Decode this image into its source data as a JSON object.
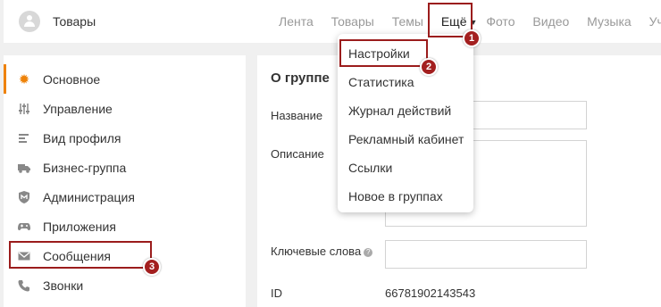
{
  "header": {
    "group_name": "Товары",
    "nav": [
      "Лента",
      "Товары",
      "Темы",
      "Ещё",
      "Фото",
      "Видео",
      "Музыка",
      "Уча"
    ]
  },
  "sidebar": {
    "items": [
      {
        "label": "Основное",
        "icon": "gear-icon"
      },
      {
        "label": "Управление",
        "icon": "sliders-icon"
      },
      {
        "label": "Вид профиля",
        "icon": "lines-icon"
      },
      {
        "label": "Бизнес-группа",
        "icon": "truck-icon"
      },
      {
        "label": "Администрация",
        "icon": "shield-icon"
      },
      {
        "label": "Приложения",
        "icon": "gamepad-icon"
      },
      {
        "label": "Сообщения",
        "icon": "envelope-icon"
      },
      {
        "label": "Звонки",
        "icon": "phone-icon"
      }
    ]
  },
  "dropdown": {
    "items": [
      "Настройки",
      "Статистика",
      "Журнал действий",
      "Рекламный кабинет",
      "Ссылки",
      "Новое в группах"
    ]
  },
  "main": {
    "title": "О группе",
    "name_label": "Название",
    "desc_label": "Описание",
    "keywords_label": "Ключевые слова",
    "help_glyph": "?",
    "id_label": "ID",
    "id_value": "66781902143543"
  },
  "annotations": {
    "badges": [
      "1",
      "2",
      "3"
    ],
    "color": "#a31f1f"
  },
  "colors": {
    "accent": "#ee8208"
  }
}
